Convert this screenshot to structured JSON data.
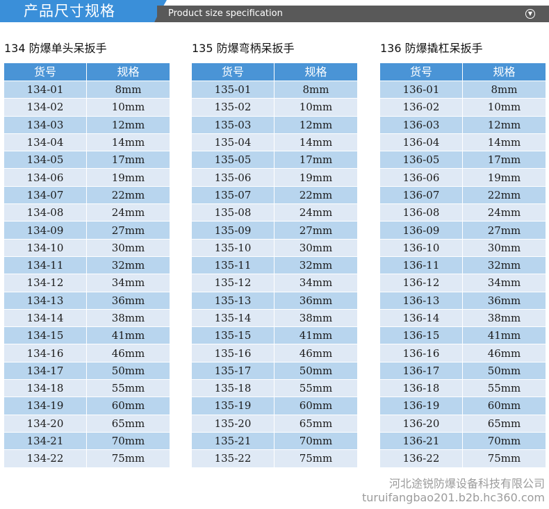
{
  "header": {
    "title": "产品尺寸规格",
    "subtitle": "Product size specification",
    "toggle_icon": "chevron-down-circle-icon",
    "colors": {
      "accent": "#3a8fd9",
      "bar": "#595959"
    }
  },
  "tables": [
    {
      "title": "134 防爆单头呆扳手",
      "headers": [
        "货号",
        "规格"
      ],
      "rows": [
        [
          "134-01",
          "8mm"
        ],
        [
          "134-02",
          "10mm"
        ],
        [
          "134-03",
          "12mm"
        ],
        [
          "134-04",
          "14mm"
        ],
        [
          "134-05",
          "17mm"
        ],
        [
          "134-06",
          "19mm"
        ],
        [
          "134-07",
          "22mm"
        ],
        [
          "134-08",
          "24mm"
        ],
        [
          "134-09",
          "27mm"
        ],
        [
          "134-10",
          "30mm"
        ],
        [
          "134-11",
          "32mm"
        ],
        [
          "134-12",
          "34mm"
        ],
        [
          "134-13",
          "36mm"
        ],
        [
          "134-14",
          "38mm"
        ],
        [
          "134-15",
          "41mm"
        ],
        [
          "134-16",
          "46mm"
        ],
        [
          "134-17",
          "50mm"
        ],
        [
          "134-18",
          "55mm"
        ],
        [
          "134-19",
          "60mm"
        ],
        [
          "134-20",
          "65mm"
        ],
        [
          "134-21",
          "70mm"
        ],
        [
          "134-22",
          "75mm"
        ]
      ]
    },
    {
      "title": "135 防爆弯柄呆扳手",
      "headers": [
        "货号",
        "规格"
      ],
      "rows": [
        [
          "135-01",
          "8mm"
        ],
        [
          "135-02",
          "10mm"
        ],
        [
          "135-03",
          "12mm"
        ],
        [
          "135-04",
          "14mm"
        ],
        [
          "135-05",
          "17mm"
        ],
        [
          "135-06",
          "19mm"
        ],
        [
          "135-07",
          "22mm"
        ],
        [
          "135-08",
          "24mm"
        ],
        [
          "135-09",
          "27mm"
        ],
        [
          "135-10",
          "30mm"
        ],
        [
          "135-11",
          "32mm"
        ],
        [
          "135-12",
          "34mm"
        ],
        [
          "135-13",
          "36mm"
        ],
        [
          "135-14",
          "38mm"
        ],
        [
          "135-15",
          "41mm"
        ],
        [
          "135-16",
          "46mm"
        ],
        [
          "135-17",
          "50mm"
        ],
        [
          "135-18",
          "55mm"
        ],
        [
          "135-19",
          "60mm"
        ],
        [
          "135-20",
          "65mm"
        ],
        [
          "135-21",
          "70mm"
        ],
        [
          "135-22",
          "75mm"
        ]
      ]
    },
    {
      "title": "136 防爆撬杠呆扳手",
      "headers": [
        "货号",
        "规格"
      ],
      "rows": [
        [
          "136-01",
          "8mm"
        ],
        [
          "136-02",
          "10mm"
        ],
        [
          "136-03",
          "12mm"
        ],
        [
          "136-04",
          "14mm"
        ],
        [
          "136-05",
          "17mm"
        ],
        [
          "136-06",
          "19mm"
        ],
        [
          "136-07",
          "22mm"
        ],
        [
          "136-08",
          "24mm"
        ],
        [
          "136-09",
          "27mm"
        ],
        [
          "136-10",
          "30mm"
        ],
        [
          "136-11",
          "32mm"
        ],
        [
          "136-12",
          "34mm"
        ],
        [
          "136-13",
          "36mm"
        ],
        [
          "136-14",
          "38mm"
        ],
        [
          "136-15",
          "41mm"
        ],
        [
          "136-16",
          "46mm"
        ],
        [
          "136-17",
          "50mm"
        ],
        [
          "136-18",
          "55mm"
        ],
        [
          "136-19",
          "60mm"
        ],
        [
          "136-20",
          "65mm"
        ],
        [
          "136-21",
          "70mm"
        ],
        [
          "136-22",
          "75mm"
        ]
      ]
    }
  ],
  "watermark": {
    "company": "河北途锐防爆设备科技有限公司",
    "url": "turuifangbao201.b2b.hc360.com"
  },
  "colors": {
    "header_cell": "#4a94d6",
    "row_odd": "#b8d5ee",
    "row_even": "#dfe9f5"
  }
}
